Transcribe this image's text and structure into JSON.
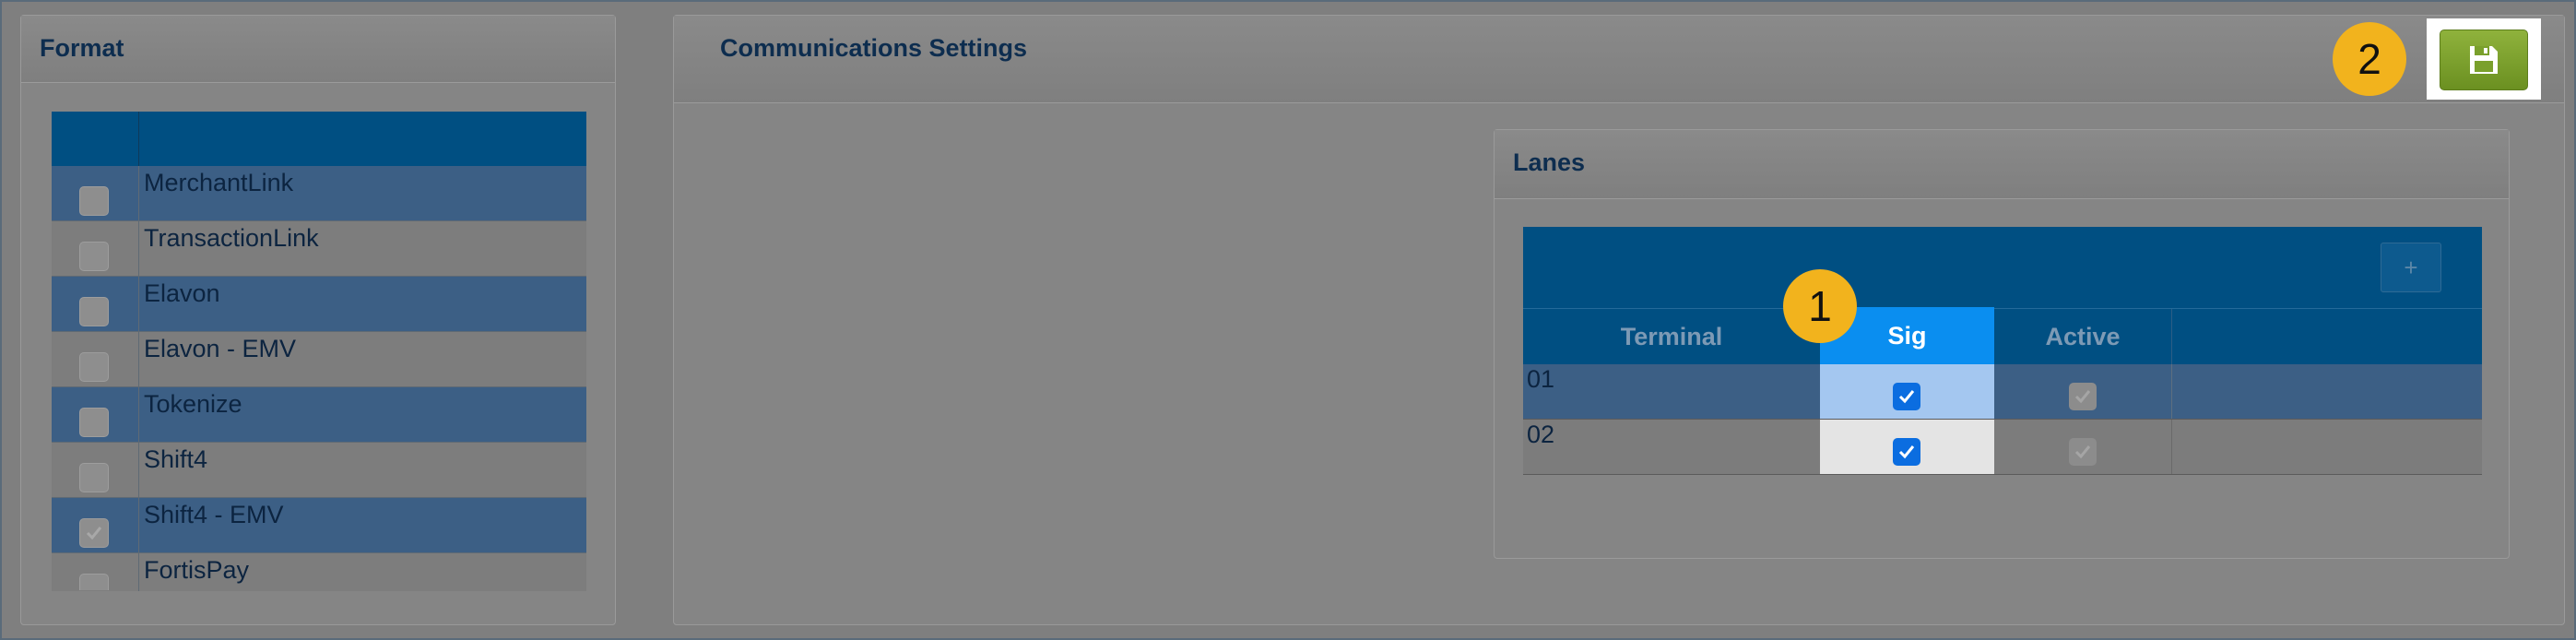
{
  "format_panel": {
    "title": "Format",
    "items": [
      {
        "label": "MerchantLink",
        "checked": false
      },
      {
        "label": "TransactionLink",
        "checked": false
      },
      {
        "label": "Elavon",
        "checked": false
      },
      {
        "label": "Elavon - EMV",
        "checked": false
      },
      {
        "label": "Tokenize",
        "checked": false
      },
      {
        "label": "Shift4",
        "checked": false
      },
      {
        "label": "Shift4 - EMV",
        "checked": true
      },
      {
        "label": "FortisPay",
        "checked": false
      }
    ]
  },
  "comm_panel": {
    "title": "Communications Settings"
  },
  "lanes": {
    "title": "Lanes",
    "add_label": "+",
    "columns": {
      "terminal": "Terminal",
      "sig": "Sig",
      "active": "Active"
    },
    "rows": [
      {
        "terminal": "01",
        "sig": true,
        "active": true
      },
      {
        "terminal": "02",
        "sig": true,
        "active": true
      }
    ]
  },
  "badges": {
    "one": "1",
    "two": "2"
  },
  "save": {
    "icon": "floppy-disk-icon"
  },
  "colors": {
    "header_blue": "#004f82",
    "sig_header": "#0a8ef0",
    "save_green": "#7aa02c",
    "badge": "#f2b31d",
    "checkbox": "#0b6de0"
  }
}
